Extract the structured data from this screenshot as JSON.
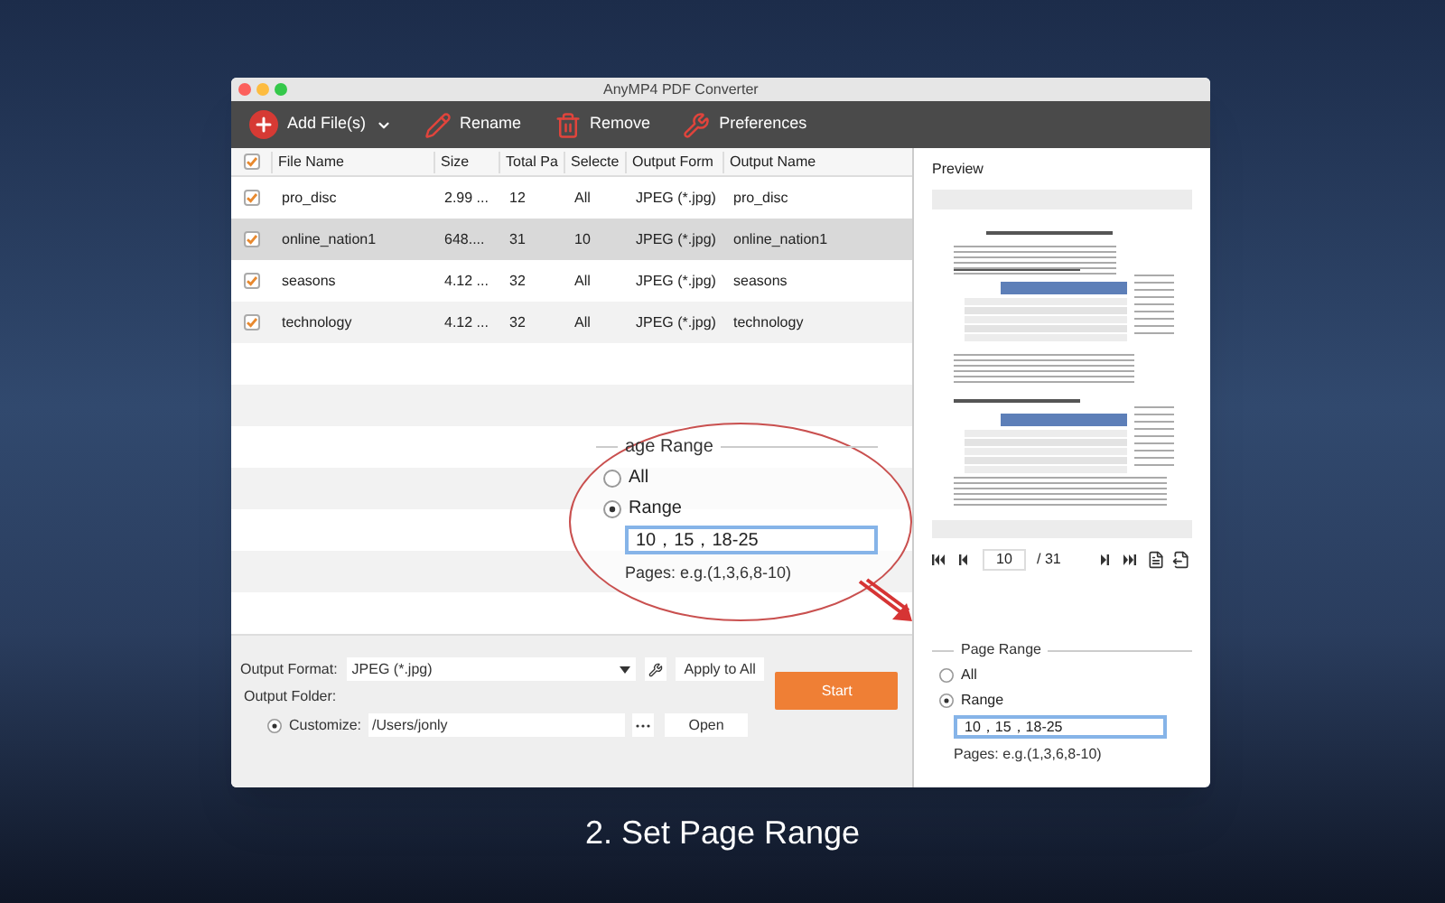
{
  "window": {
    "title": "AnyMP4 PDF Converter"
  },
  "toolbar": [
    {
      "kind": "add",
      "label": "Add File(s)"
    },
    {
      "kind": "rename",
      "label": "Rename"
    },
    {
      "kind": "remove",
      "label": "Remove"
    },
    {
      "kind": "preferences",
      "label": "Preferences"
    }
  ],
  "table": {
    "all_checked": true,
    "columns": [
      "File Name",
      "Size",
      "Total Pa",
      "Selecte",
      "Output Form",
      "Output Name"
    ],
    "rows": [
      {
        "checked": true,
        "selected": false,
        "cells": [
          "pro_disc",
          "2.99 ...",
          "12",
          "All",
          "JPEG (*.jpg)",
          "pro_disc"
        ]
      },
      {
        "checked": true,
        "selected": true,
        "cells": [
          "online_nation1",
          "648....",
          "31",
          "10",
          "JPEG (*.jpg)",
          "online_nation1"
        ]
      },
      {
        "checked": true,
        "selected": false,
        "cells": [
          "seasons",
          "4.12 ...",
          "32",
          "All",
          "JPEG (*.jpg)",
          "seasons"
        ]
      },
      {
        "checked": true,
        "selected": false,
        "cells": [
          "technology",
          "4.12 ...",
          "32",
          "All",
          "JPEG (*.jpg)",
          "technology"
        ]
      }
    ]
  },
  "output": {
    "format_label": "Output Format:",
    "format_value": "JPEG (*.jpg)",
    "apply_button": "Apply to All",
    "folder_label": "Output Folder:",
    "customize_label": "Customize:",
    "customize_selected": true,
    "path": "/Users/jonly",
    "open_button": "Open",
    "start_button": "Start"
  },
  "preview": {
    "title": "Preview",
    "page": "10",
    "total": "/ 31"
  },
  "page_range": {
    "legend": "Page Range",
    "options": [
      {
        "label": "All",
        "selected": false
      },
      {
        "label": "Range",
        "selected": true
      }
    ],
    "value": "10，15，18-25",
    "hint": "Pages: e.g.(1,3,6,8-10)"
  },
  "callout": {
    "legend": "age Range",
    "options": [
      {
        "label": "All",
        "selected": false
      },
      {
        "label": "Range",
        "selected": true
      }
    ],
    "value": "10，15，18-25",
    "hint": "Pages: e.g.(1,3,6,8-10)"
  },
  "caption": "2. Set Page Range"
}
